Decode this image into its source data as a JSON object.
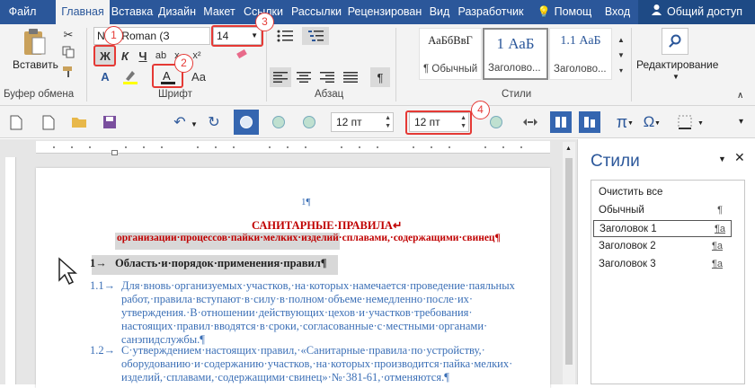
{
  "tabs": [
    "Файл",
    "Главная",
    "Вставка",
    "Дизайн",
    "Макет",
    "Ссылки",
    "Рассылки",
    "Рецензирован",
    "Вид",
    "Разработчик",
    "Помощ",
    "Вход",
    "Общий доступ"
  ],
  "clipboard": {
    "paste_label": "Вставить",
    "group_label": "Буфер обмена"
  },
  "font": {
    "name": "New Roman (З",
    "size": "14",
    "bold": "Ж",
    "italic": "К",
    "underline": "Ч",
    "group_label": "Шрифт"
  },
  "paragraph": {
    "group_label": "Абзац",
    "pilcrow": "¶"
  },
  "styles": {
    "group_label": "Стили",
    "items": [
      {
        "preview": "АаБбВвГ",
        "name": "¶ Обычный"
      },
      {
        "preview": "1 АаБ",
        "name": "Заголово..."
      },
      {
        "preview": "1.1 АаБ",
        "name": "Заголово..."
      }
    ]
  },
  "editing": {
    "label": "Редактирование"
  },
  "callouts": [
    "1",
    "2",
    "3",
    "4"
  ],
  "qat": {
    "spacing_before": "12 пт",
    "spacing_after": "12 пт"
  },
  "styles_pane": {
    "title": "Стили",
    "items": [
      {
        "label": "Очистить все",
        "mark": ""
      },
      {
        "label": "Обычный",
        "mark": "¶"
      },
      {
        "label": "Заголовок 1",
        "mark": "¶a"
      },
      {
        "label": "Заголовок 2",
        "mark": "¶a"
      },
      {
        "label": "Заголовок 3",
        "mark": "¶a"
      }
    ]
  },
  "document": {
    "page_marker": "1¶",
    "title": "САНИТАРНЫЕ·ПРАВИЛА↵",
    "subtitle": "организации·процессов·пайки·мелких·изделий·сплавами,·содержащими·свинец¶",
    "heading_num": "1→",
    "heading": "Область·и·порядок·применения·правил¶",
    "p1_num": "1.1→",
    "p1": [
      "Для·вновь·организуемых·участков,·на·которых·намечается·проведение·паяльных",
      "работ,·правила·вступают·в·силу·в·полном·объеме·немедленно·после·их·",
      "утверждения.·В·отношении·действующих·цехов·и·участков·требования·",
      "настоящих·правил·вводятся·в·сроки,·согласованные·с·местными·органами·",
      "санэпидслужбы.¶"
    ],
    "p2_num": "1.2→",
    "p2": [
      "С·утверждением·настоящих·правил,·«Санитарные·правила·по·устройству,·",
      "оборудованию·и·содержанию·участков,·на·которых·производится·пайка·мелких·",
      "изделий,·сплавами,·содержащими·свинец»·№·381-61,·отменяются.¶"
    ]
  },
  "colors": {
    "accent": "#2b579a",
    "callout": "#e53935",
    "heading_text": "#c00000",
    "body_text": "#3b6fb6"
  }
}
